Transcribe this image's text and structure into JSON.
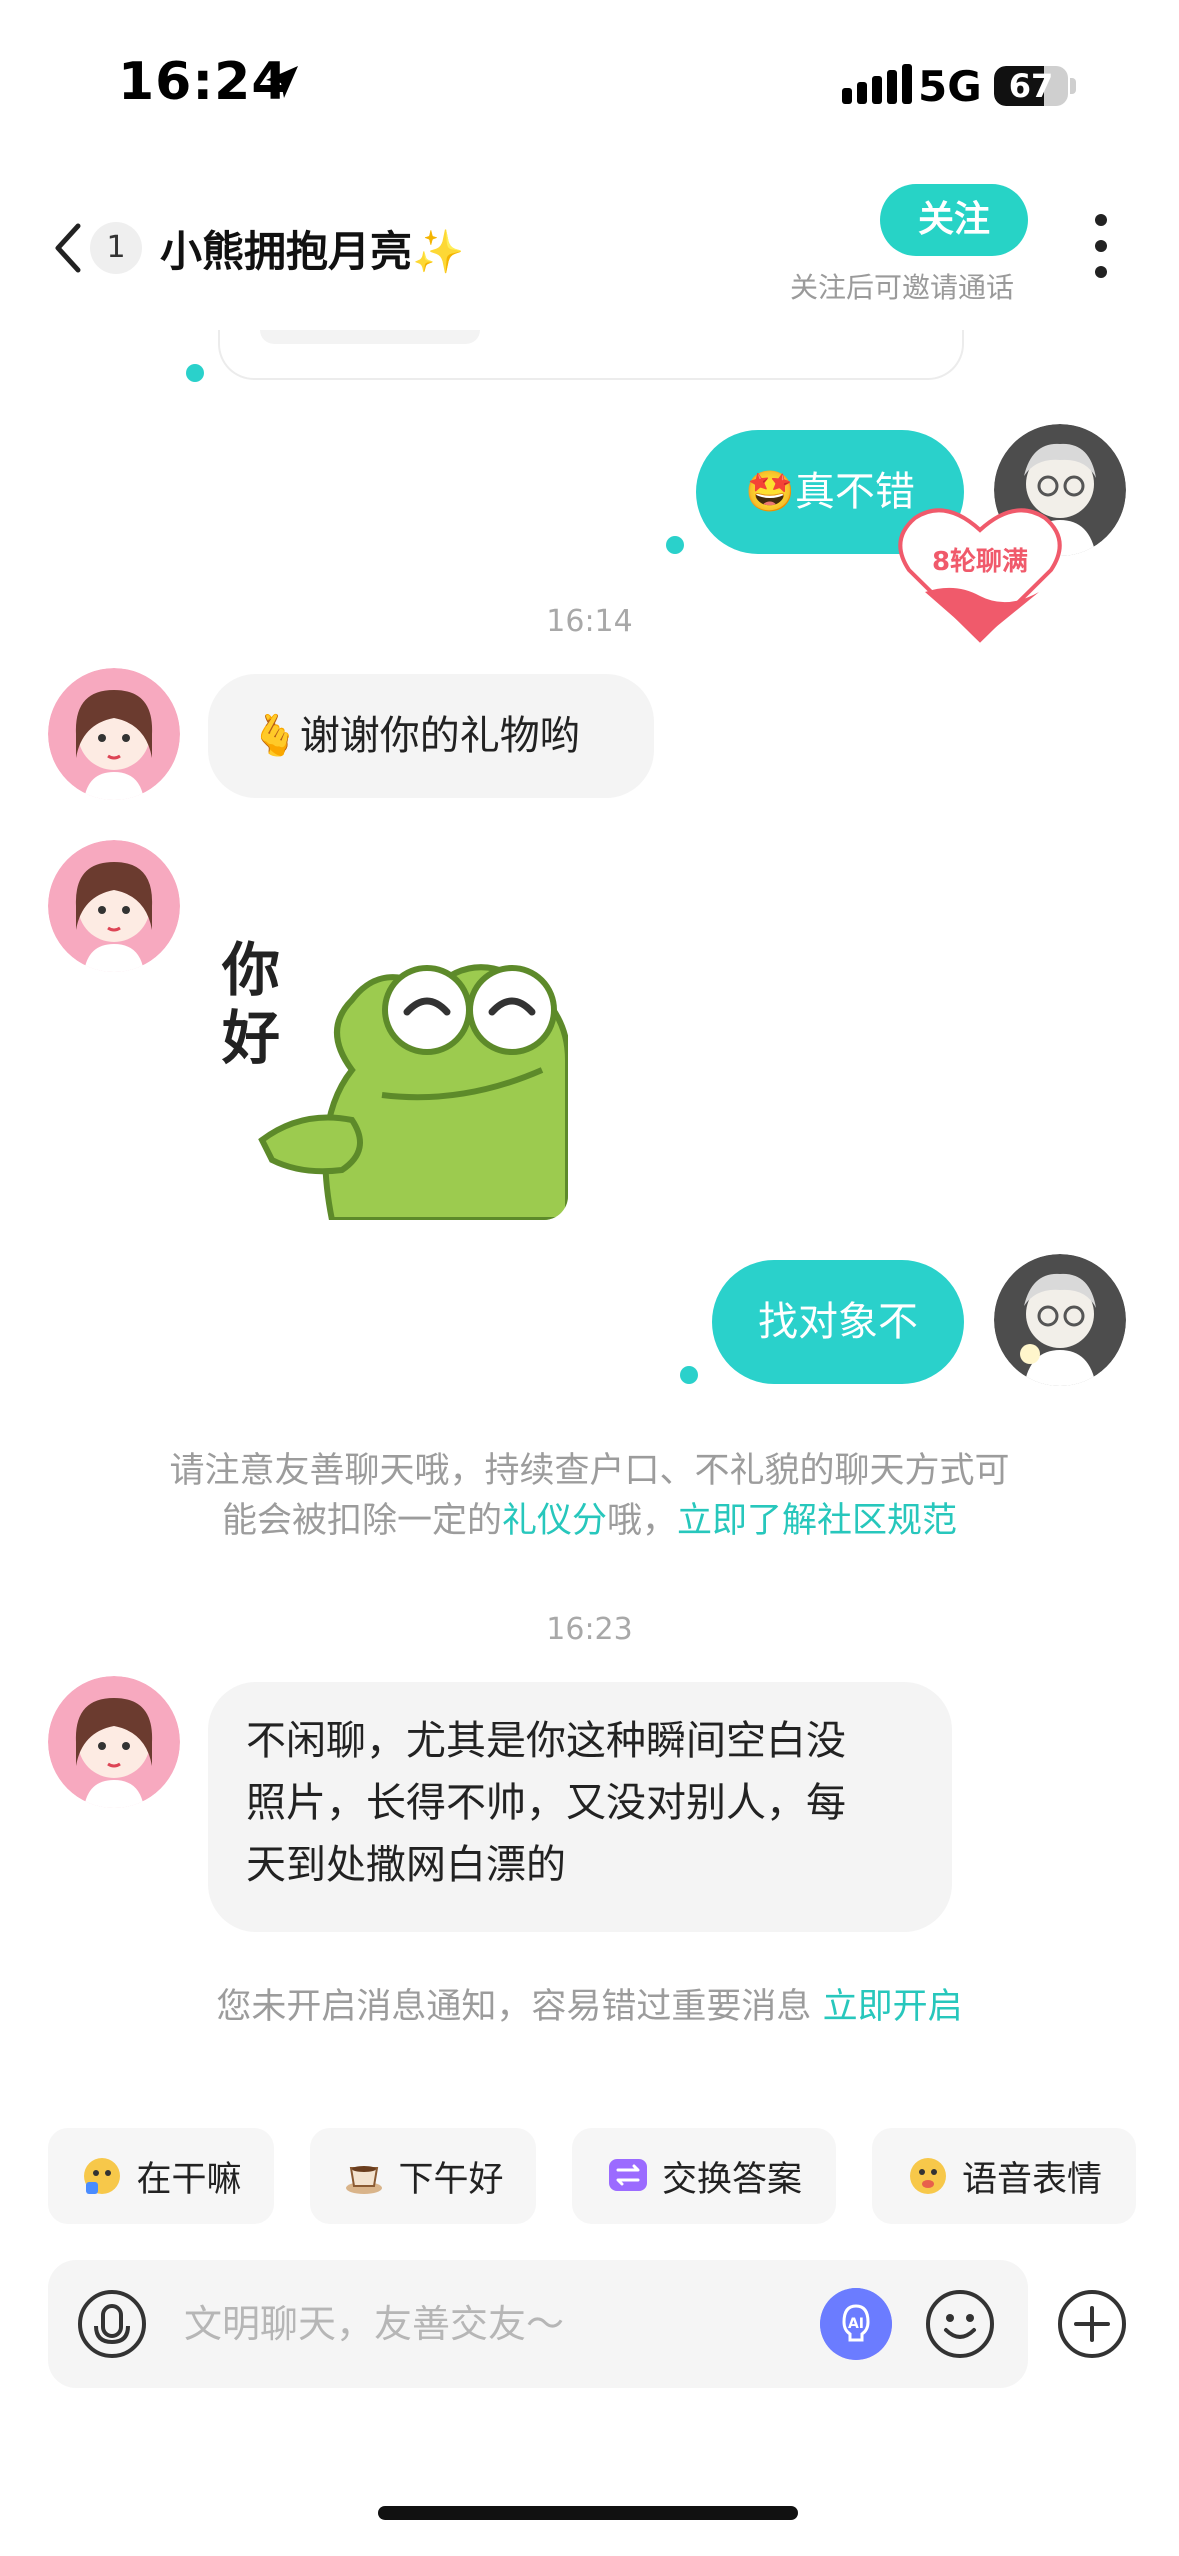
{
  "status_bar": {
    "time": "16:24",
    "network": "5G",
    "battery": "67",
    "battery_level": 0.67
  },
  "header": {
    "unread_count": "1",
    "title": "小熊拥抱月亮",
    "title_emoji": "✨",
    "follow_label": "关注",
    "follow_hint": "关注后可邀请通话"
  },
  "messages": {
    "m1_emoji": "🤩",
    "m1_text": "真不错",
    "badge_text": "8轮聊满",
    "time_1": "16:14",
    "m2_emoji": "🫰",
    "m2_text": "谢谢你的礼物哟",
    "sticker_text_1": "你",
    "sticker_text_2": "好",
    "m4_text": "找对象不",
    "notice_line1": "请注意友善聊天哦，持续查户口、不礼貌的聊天方式可",
    "notice_line2_a": "能会被扣除一定的",
    "notice_line2_link1": "礼仪分",
    "notice_line2_b": "哦，",
    "notice_line2_link2": "立即了解社区规范",
    "time_2": "16:23",
    "m5_line1": "不闲聊，尤其是你这种瞬间空白没",
    "m5_line2": "照片，长得不帅，又没对别人，每",
    "m5_line3": "天到处撒网白漂的",
    "notif_text": "您未开启消息通知，容易错过重要消息",
    "notif_link": "立即开启"
  },
  "quick_replies": [
    {
      "icon": "thinking-face",
      "label": "在干嘛"
    },
    {
      "icon": "coffee-cup",
      "label": "下午好"
    },
    {
      "icon": "swap-icon",
      "label": "交换答案"
    },
    {
      "icon": "voice-face",
      "label": "语音表情"
    }
  ],
  "input": {
    "placeholder": "文明聊天，友善交友～"
  },
  "colors": {
    "accent": "#2ad1cb",
    "bubble_left": "#f4f4f4",
    "link": "#27c7bc",
    "badge": "#f05a6b"
  }
}
